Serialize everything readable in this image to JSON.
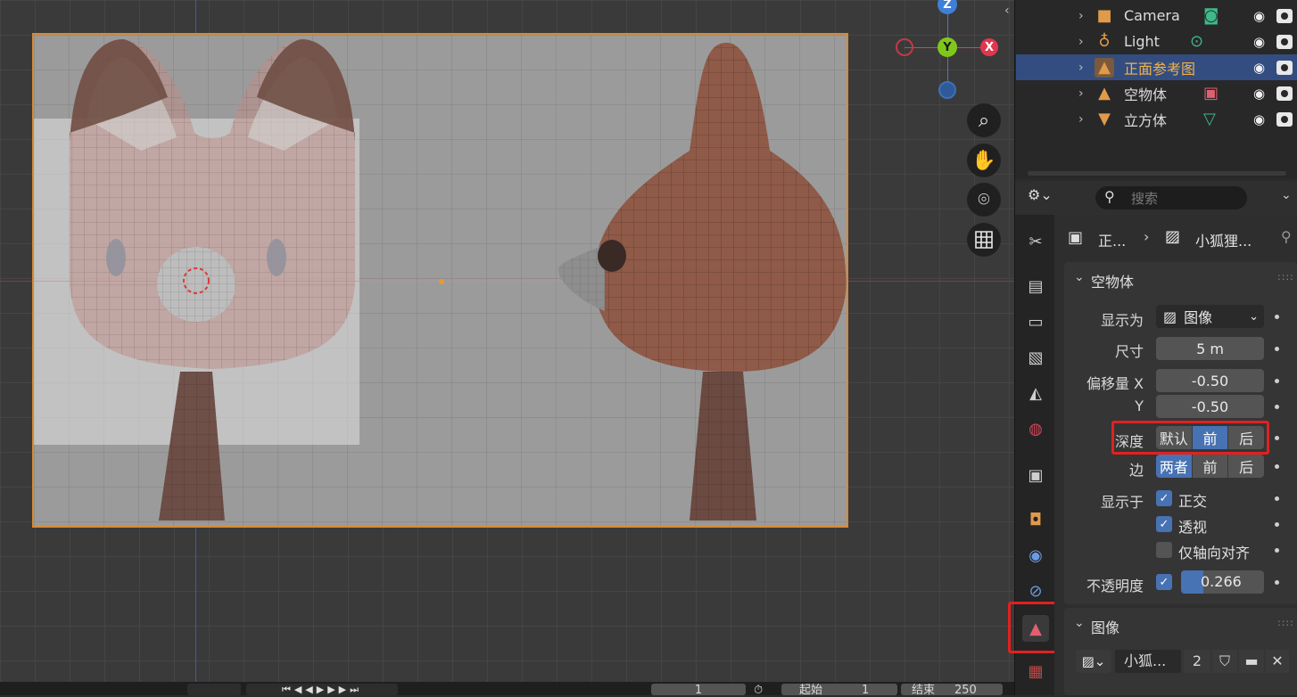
{
  "viewport": {
    "gizmo": {
      "z": "Z",
      "y": "Y",
      "x": "X"
    }
  },
  "outliner": {
    "items": [
      {
        "label": "Camera",
        "icon": "camera-icon",
        "data_icon": "camera-data-icon",
        "selected": false
      },
      {
        "label": "Light",
        "icon": "light-icon",
        "data_icon": "light-data-icon",
        "selected": false
      },
      {
        "label": "正面参考图",
        "icon": "image-empty-icon",
        "data_icon": "",
        "selected": true
      },
      {
        "label": "空物体",
        "icon": "image-empty-icon",
        "data_icon": "image-data-icon",
        "selected": false
      },
      {
        "label": "立方体",
        "icon": "mesh-icon",
        "data_icon": "mesh-data-icon",
        "selected": false
      }
    ]
  },
  "properties": {
    "search_placeholder": "搜索",
    "breadcrumb": {
      "object": "正...",
      "data": "小狐狸..."
    },
    "empty_panel": {
      "title": "空物体",
      "display_as_label": "显示为",
      "display_as_value": "图像",
      "size_label": "尺寸",
      "size_value": "5 m",
      "offset_x_label": "偏移量 X",
      "offset_x_value": "-0.50",
      "offset_y_label": "Y",
      "offset_y_value": "-0.50",
      "depth_label": "深度",
      "depth_options": [
        "默认",
        "前",
        "后"
      ],
      "depth_selected": "前",
      "side_label": "边",
      "side_options": [
        "两者",
        "前",
        "后"
      ],
      "side_selected": "两者",
      "show_in_label": "显示于",
      "show_orthographic": "正交",
      "show_perspective": "透视",
      "show_axis_aligned": "仅轴向对齐",
      "opacity_label": "不透明度",
      "opacity_value": "0.266"
    },
    "image_panel": {
      "title": "图像",
      "image_name": "小狐...",
      "users": "2"
    }
  },
  "timeline": {
    "current_frame": "1",
    "start_label": "起始",
    "start_value": "1",
    "end_label": "结束",
    "end_value": "250"
  },
  "colors": {
    "accent": "#4772b3",
    "selection_outline": "#d88a35",
    "highlight_box": "#e32020"
  }
}
